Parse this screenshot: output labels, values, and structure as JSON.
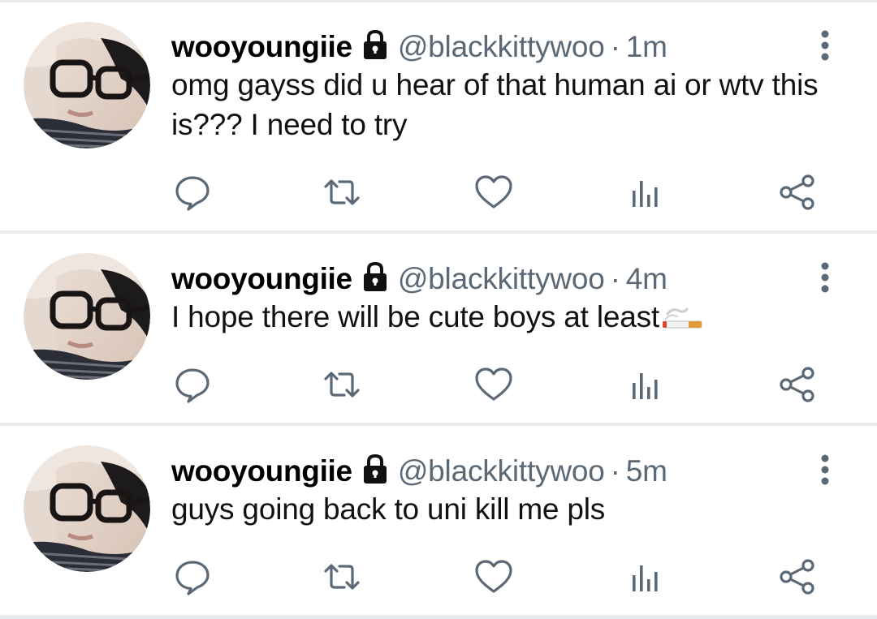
{
  "colors": {
    "text": "#111111",
    "secondary": "#5b6875",
    "separator": "#e8ebee",
    "icon": "#5b6875"
  },
  "icons": {
    "lock": "lock-icon",
    "more": "more-vertical-icon",
    "reply": "reply-icon",
    "retweet": "retweet-icon",
    "like": "heart-icon",
    "views": "bar-chart-icon",
    "share": "share-icon",
    "emoji": "cigarette-emoji-icon"
  },
  "tweets": [
    {
      "name": "wooyoungiie",
      "handle": "@blackkittywoo",
      "separator": "·",
      "time": "1m",
      "text": "omg gayss did u hear of that human ai or wtv this is??? I need to try"
    },
    {
      "name": "wooyoungiie",
      "handle": "@blackkittywoo",
      "separator": "·",
      "time": "4m",
      "text": "I hope there will be cute boys at least"
    },
    {
      "name": "wooyoungiie",
      "handle": "@blackkittywoo",
      "separator": "·",
      "time": "5m",
      "text": "guys going back to uni kill me pls"
    }
  ]
}
